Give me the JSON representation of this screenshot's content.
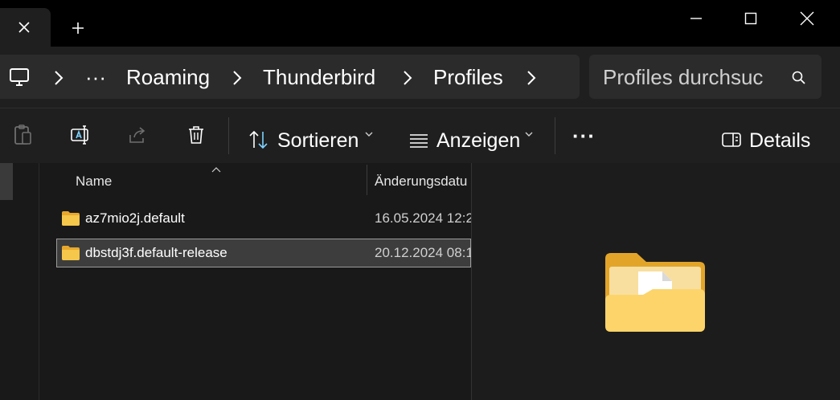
{
  "window": {
    "new_tab_label": "+",
    "controls": [
      "minimize",
      "maximize",
      "close"
    ]
  },
  "address": {
    "ellipsis": "···",
    "breadcrumbs": [
      "Roaming",
      "Thunderbird",
      "Profiles"
    ]
  },
  "search": {
    "placeholder": "Profiles durchsuc"
  },
  "toolbar": {
    "sort_label": "Sortieren",
    "view_label": "Anzeigen",
    "more_label": "···",
    "details_label": "Details"
  },
  "columns": {
    "name": "Name",
    "modified": "Änderungsdatu"
  },
  "files": [
    {
      "name": "az7mio2j.default",
      "modified": "16.05.2024 12:2",
      "selected": false
    },
    {
      "name": "dbstdj3f.default-release",
      "modified": "20.12.2024 08:1",
      "selected": true
    }
  ],
  "colors": {
    "folder": "#f5c74a",
    "background": "#1c1c1c",
    "accent": "#60cdff"
  }
}
